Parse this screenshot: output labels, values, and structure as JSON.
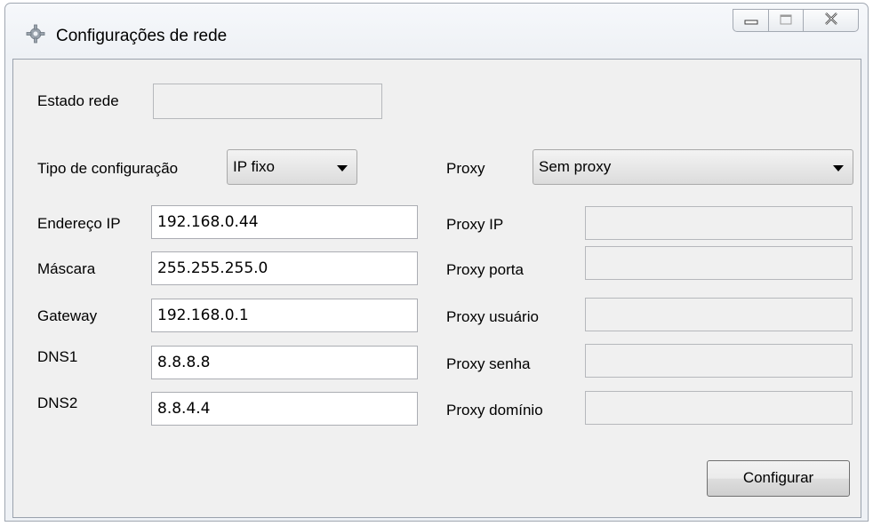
{
  "window": {
    "title": "Configurações de rede",
    "app_icon": "gear-icon",
    "controls": [
      "minimize-icon",
      "maximize-icon",
      "close-icon"
    ]
  },
  "status": {
    "label": "Estado rede",
    "value": ""
  },
  "config_type": {
    "label": "Tipo de configuração",
    "selected": "IP fixo"
  },
  "network": {
    "ip_label": "Endereço IP",
    "ip_value": "192.168.0.44",
    "mask_label": "Máscara",
    "mask_value": "255.255.255.0",
    "gateway_label": "Gateway",
    "gateway_value": "192.168.0.1",
    "dns1_label": "DNS1",
    "dns1_value": "8.8.8.8",
    "dns2_label": "DNS2",
    "dns2_value": "8.8.4.4"
  },
  "proxy": {
    "label": "Proxy",
    "selected": "Sem proxy",
    "ip_label": "Proxy IP",
    "ip_value": "",
    "port_label": "Proxy porta",
    "port_value": "",
    "user_label": "Proxy usuário",
    "user_value": "",
    "password_label": "Proxy senha",
    "password_value": "",
    "domain_label": "Proxy domínio",
    "domain_value": ""
  },
  "actions": {
    "configure_label": "Configurar"
  }
}
